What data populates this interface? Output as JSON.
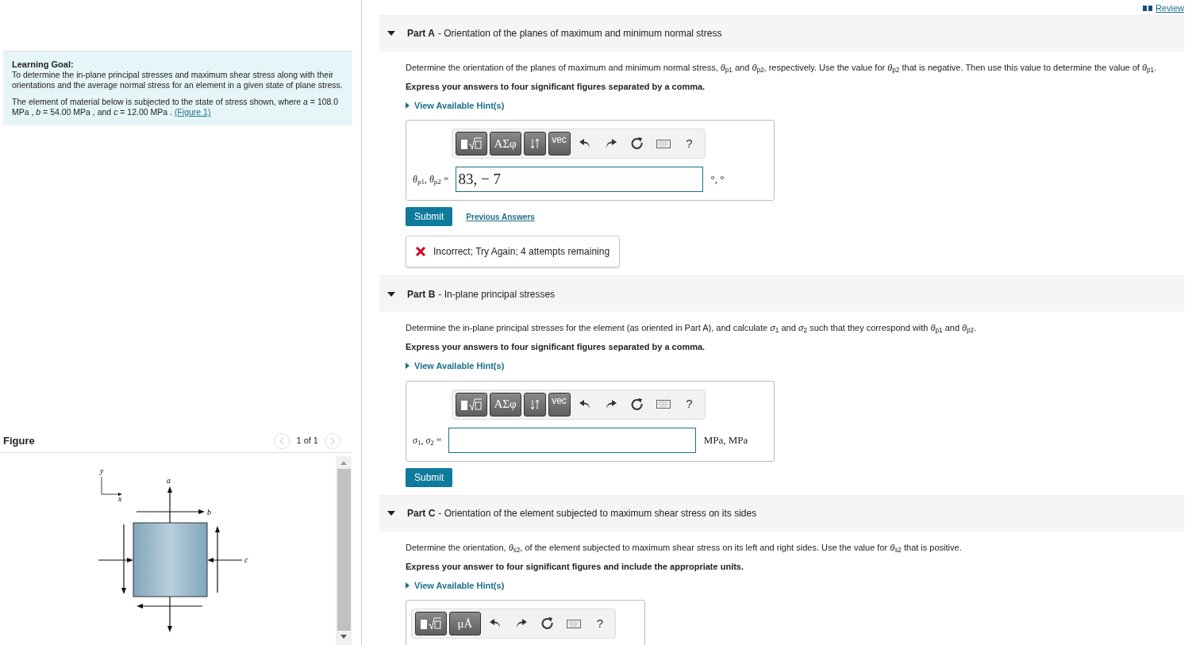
{
  "review_link": "Review",
  "learning_goal": {
    "title": "Learning Goal:",
    "text": "To determine the in-plane principal stresses and maximum shear stress along with their orientations and the average normal stress for an element in a given state of plane stress.",
    "problem": "The element of material below is subjected to the state of stress shown, where *a* = 108.0 MPa , *b* = 54.00 MPa , and *c* = 12.00 MPa .",
    "figure_link": "(Figure 1)"
  },
  "figure": {
    "title": "Figure",
    "pager": "1 of 1",
    "axis_labels": [
      "y",
      "x"
    ],
    "stress_labels": [
      "a",
      "b",
      "c"
    ]
  },
  "parts": [
    {
      "label": "Part A",
      "title": "- Orientation of the planes of maximum and minimum normal stress",
      "expanded": true,
      "prompt": "Determine the orientation of the planes of maximum and minimum normal stress, *θ*$_{p1}$ and *θ*$_{p2}$, respectively.  Use the value for *θ*$_{p2}$ that is negative. Then use this value to determine the value of *θ*$_{p1}$.",
      "instruction": "Express your answers to four significant figures separated by a comma.",
      "hint_link": "View Available Hint(s)",
      "toolbar": [
        {
          "kind": "templates"
        },
        {
          "kind": "greek",
          "text": "ΑΣφ"
        },
        {
          "kind": "arrows"
        },
        {
          "kind": "vec",
          "text": "vec"
        },
        {
          "kind": "undo"
        },
        {
          "kind": "redo"
        },
        {
          "kind": "reset"
        },
        {
          "kind": "keyboard"
        },
        {
          "kind": "help",
          "text": "?"
        }
      ],
      "answer_label": "*θ*$_{p1}$, *θ*$_{p2}$ =",
      "value": "83, − 7",
      "units": "°, °",
      "submit": "Submit",
      "previous_answers": "Previous Answers",
      "feedback": {
        "kind": "incorrect",
        "text": "Incorrect; Try Again; 4 attempts remaining"
      }
    },
    {
      "label": "Part B",
      "title": "- In-plane principal stresses",
      "expanded": true,
      "prompt": "Determine the in-plane principal stresses for the element (as oriented in Part A), and calculate *σ*$_{1}$ and *σ*$_{2}$ such that they correspond with *θ*$_{p1}$ and *θ*$_{p2}$.",
      "instruction": "Express your answers to four significant figures separated by a comma.",
      "hint_link": "View Available Hint(s)",
      "toolbar": [
        {
          "kind": "templates"
        },
        {
          "kind": "greek",
          "text": "ΑΣφ"
        },
        {
          "kind": "arrows"
        },
        {
          "kind": "vec",
          "text": "vec"
        },
        {
          "kind": "undo"
        },
        {
          "kind": "redo"
        },
        {
          "kind": "reset"
        },
        {
          "kind": "keyboard"
        },
        {
          "kind": "help",
          "text": "?"
        }
      ],
      "answer_label": "*σ*$_{1}$, *σ*$_{2}$ =",
      "units": "MPa, MPa",
      "submit": "Submit"
    },
    {
      "label": "Part C",
      "title": "- Orientation of the element subjected to maximum shear stress on its sides",
      "expanded": true,
      "prompt": "Determine the orientation, *θ*$_{s2}$, of the element subjected to maximum shear stress on its left and right sides. Use the value for *θ*$_{s2}$ that is positive.",
      "instruction": "Express your answer to four significant figures and include the appropriate units.",
      "hint_link": "View Available Hint(s)",
      "toolbar": [
        {
          "kind": "templates"
        },
        {
          "kind": "units",
          "text": "μÅ"
        },
        {
          "kind": "undo"
        },
        {
          "kind": "redo"
        },
        {
          "kind": "reset"
        },
        {
          "kind": "keyboard"
        },
        {
          "kind": "help",
          "text": "?"
        }
      ]
    }
  ]
}
